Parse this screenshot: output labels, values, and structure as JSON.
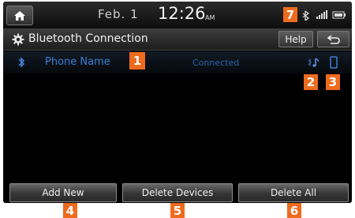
{
  "status_bar": {
    "date": "Feb. 1",
    "time": "12:26",
    "ampm": "AM"
  },
  "title_bar": {
    "title": "Bluetooth Connection",
    "help_label": "Help",
    "back_icon": "back-arrow-icon"
  },
  "device": {
    "name": "Phone Name",
    "status": "Connected",
    "audio_icon": "bluetooth-audio-icon",
    "phone_icon": "phone-icon"
  },
  "bottom_buttons": {
    "add_new": "Add New",
    "delete_devices": "Delete Devices",
    "delete_all": "Delete All"
  },
  "callouts": [
    "1",
    "2",
    "3",
    "4",
    "5",
    "6",
    "7"
  ],
  "colors": {
    "callout": "#ee6b1e",
    "device_name": "#3a7fd4",
    "connected": "#2f63a8"
  }
}
